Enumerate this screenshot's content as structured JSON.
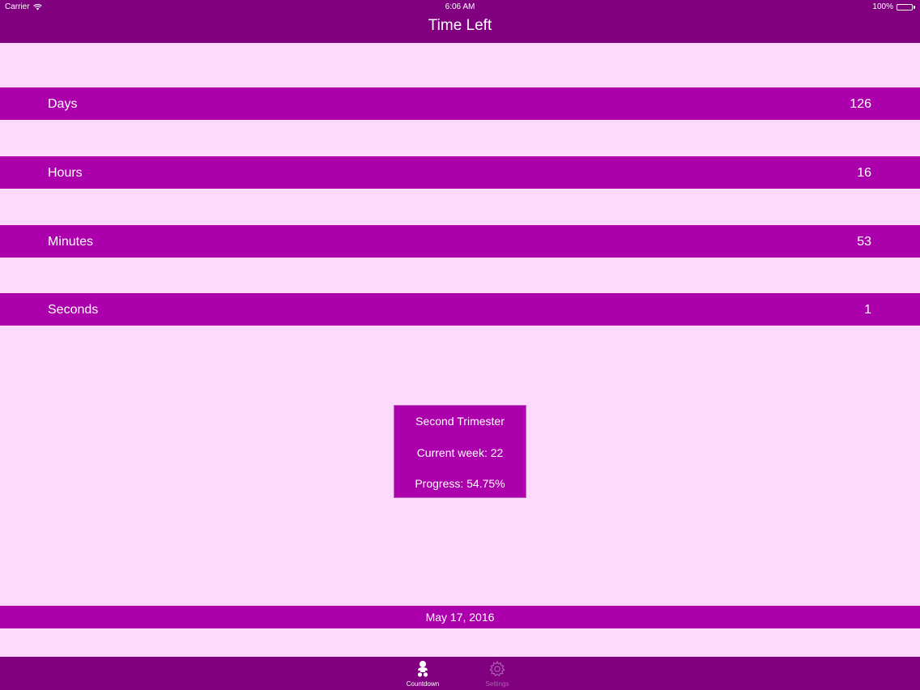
{
  "status_bar": {
    "carrier": "Carrier",
    "time": "6:06 AM",
    "battery": "100%"
  },
  "nav": {
    "title": "Time Left"
  },
  "rows": [
    {
      "label": "Days",
      "value": "126"
    },
    {
      "label": "Hours",
      "value": "16"
    },
    {
      "label": "Minutes",
      "value": "53"
    },
    {
      "label": "Seconds",
      "value": "1"
    }
  ],
  "info": {
    "trimester": "Second Trimester",
    "current_week": "Current week: 22",
    "progress": "Progress: 54.75%"
  },
  "due_date": "May 17, 2016",
  "tabs": [
    {
      "label": "Countdown",
      "icon": "baby-icon",
      "active": true
    },
    {
      "label": "Settings",
      "icon": "gear-icon",
      "active": false
    }
  ],
  "colors": {
    "background": "#fdd9fd",
    "bar": "#800080",
    "row": "#ac00ac",
    "inactive_tab": "#b060b0"
  }
}
